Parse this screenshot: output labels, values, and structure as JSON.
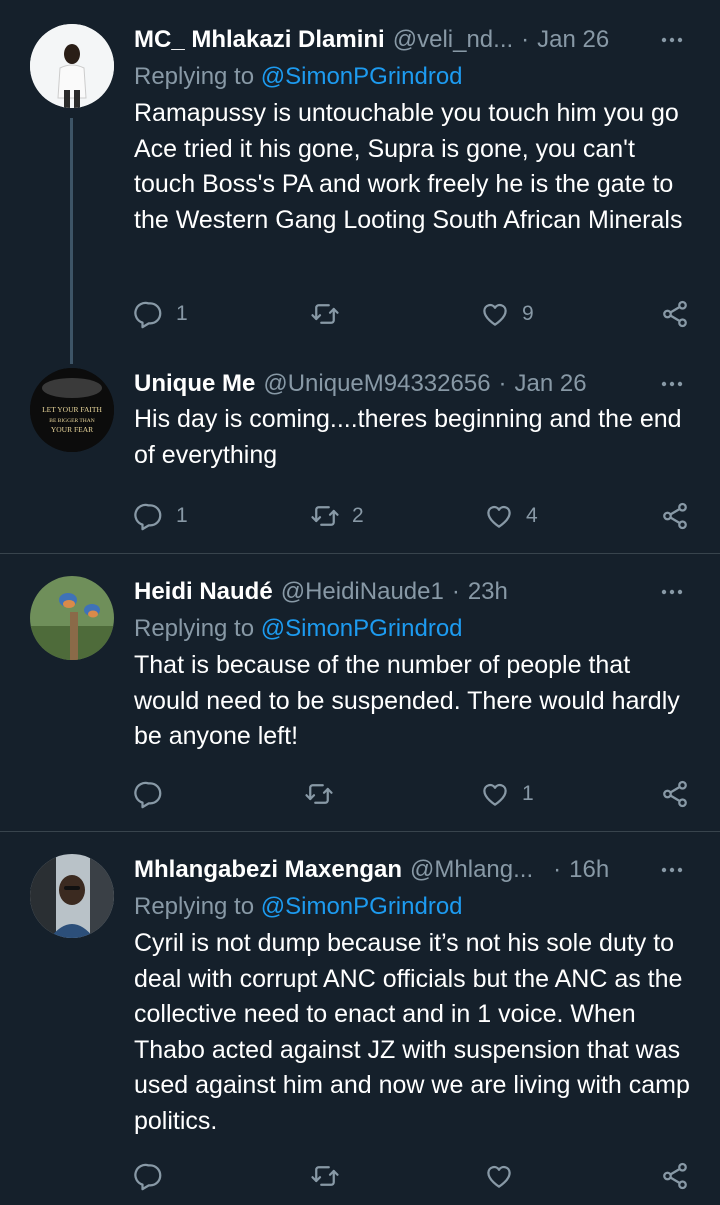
{
  "tweets": [
    {
      "name": "MC_ Mhlakazi Dlamini",
      "handle": "@veli_nd...",
      "time": "Jan 26",
      "replying_prefix": "Replying to ",
      "replying_to": "@SimonPGrindrod",
      "text": "Ramapussy is untouchable you touch him you go Ace tried it his gone, Supra is gone, you can't touch Boss's PA and work freely he is the gate to the Western Gang Looting South African Minerals",
      "replies": "1",
      "retweets": "",
      "likes": "9"
    },
    {
      "name": "Unique Me",
      "handle": "@UniqueM94332656",
      "time": "Jan 26",
      "avatar_text": [
        "LET YOUR FAITH",
        "BE BIGGER THAN",
        "YOUR FEAR"
      ],
      "text": "His day is coming....theres beginning and the end of everything",
      "replies": "1",
      "retweets": "2",
      "likes": "4"
    },
    {
      "name": "Heidi Naudé",
      "handle": "@HeidiNaude1",
      "time": "23h",
      "replying_prefix": "Replying to ",
      "replying_to": "@SimonPGrindrod",
      "text": "That is because of the number of people that would need to be suspended. There would hardly be anyone left!",
      "replies": "",
      "retweets": "",
      "likes": "1"
    },
    {
      "name": "Mhlangabezi Maxengan",
      "handle": "@Mhlang...",
      "time": "16h",
      "replying_prefix": "Replying to ",
      "replying_to": "@SimonPGrindrod",
      "text": "Cyril is not dump because it’s not his sole duty to deal with corrupt ANC officials but the ANC as the collective need to enact and in 1 voice. When Thabo acted against JZ with suspension that was used against him and now we are living with camp politics.",
      "replies": "",
      "retweets": "",
      "likes": ""
    }
  ],
  "dot_separator": "·",
  "colors": {
    "background": "#15202b",
    "muted": "#8899a6",
    "link": "#1d9bf0",
    "divider": "#38444d"
  }
}
